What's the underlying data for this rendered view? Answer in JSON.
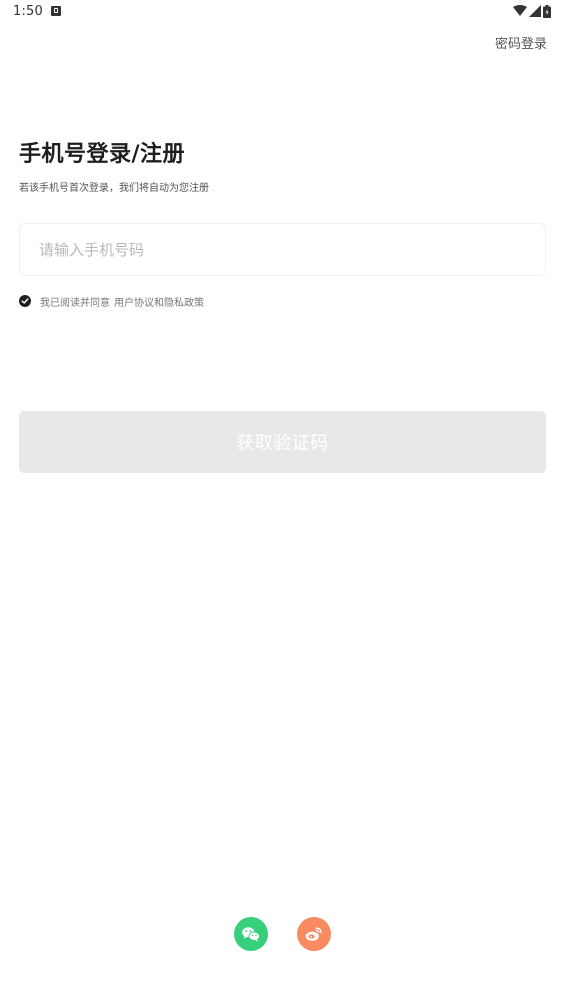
{
  "status_bar": {
    "time": "1:50",
    "icons": [
      "notification-icon",
      "wifi-icon",
      "cell-signal-icon",
      "battery-icon"
    ]
  },
  "header": {
    "password_login_link": "密码登录"
  },
  "main": {
    "title": "手机号登录/注册",
    "subtitle": "若该手机号首次登录，我们将自动为您注册",
    "phone_input": {
      "placeholder": "请输入手机号码",
      "value": ""
    },
    "agreement": {
      "checked": true,
      "prefix": "我已阅读并同意",
      "links_text": "用户协议和隐私政策"
    },
    "get_code_button": "获取验证码"
  },
  "social_login": {
    "items": [
      {
        "name": "wechat",
        "icon": "wechat-icon",
        "color": "#36cf7c"
      },
      {
        "name": "weibo",
        "icon": "weibo-icon",
        "color": "#fa8a5f"
      }
    ]
  },
  "colors": {
    "title": "#1e1e1e",
    "button_disabled_bg": "#e8e8e8",
    "button_text": "#ffffff",
    "placeholder": "#b8b8b8"
  }
}
